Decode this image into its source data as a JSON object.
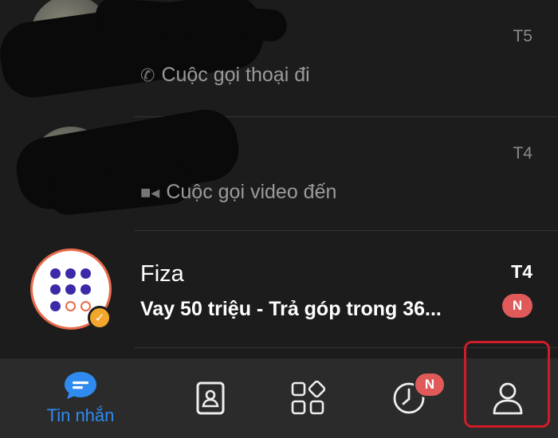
{
  "conversations": [
    {
      "name": "",
      "preview": "Cuộc gọi thoại đi",
      "preview_icon": "phone-icon",
      "time": "T5"
    },
    {
      "name": "",
      "preview": "Cuộc gọi video đến",
      "preview_icon": "video-icon",
      "time": "T4"
    },
    {
      "name": "Fiza",
      "preview": "Vay 50 triệu - Trả góp trong 36...",
      "time": "T4",
      "unread_badge": "N",
      "verified": true
    }
  ],
  "tabbar": {
    "messages_label": "Tin nhắn",
    "timeline_badge": "N",
    "active_color": "#2f8bf0",
    "badge_color": "#e05a5a"
  }
}
